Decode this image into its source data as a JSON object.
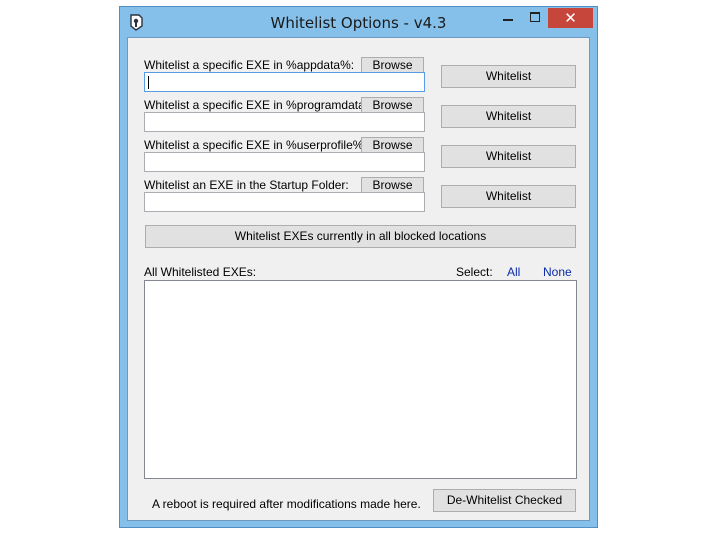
{
  "window": {
    "title": "Whitelist Options - v4.3",
    "close_glyph": "✕"
  },
  "rows": [
    {
      "label": "Whitelist a specific EXE in %appdata%:",
      "browse": "Browse",
      "value": "",
      "action": "Whitelist"
    },
    {
      "label": "Whitelist a specific EXE in %programdata%:",
      "browse": "Browse",
      "value": "",
      "action": "Whitelist"
    },
    {
      "label": "Whitelist a specific EXE in %userprofile%:",
      "browse": "Browse",
      "value": "",
      "action": "Whitelist"
    },
    {
      "label": "Whitelist an EXE in the Startup Folder:",
      "browse": "Browse",
      "value": "",
      "action": "Whitelist"
    }
  ],
  "whitelist_all_button": "Whitelist EXEs currently in all blocked locations",
  "list": {
    "label": "All Whitelisted EXEs:",
    "select_label": "Select:",
    "select_all": "All",
    "select_none": "None",
    "items": []
  },
  "footer": {
    "note": "A reboot is required after modifications made here.",
    "dewhitelist_button": "De-Whitelist Checked"
  },
  "colors": {
    "frame": "#84c0ea",
    "close_button": "#c7463c",
    "link": "#0b2aa8"
  }
}
